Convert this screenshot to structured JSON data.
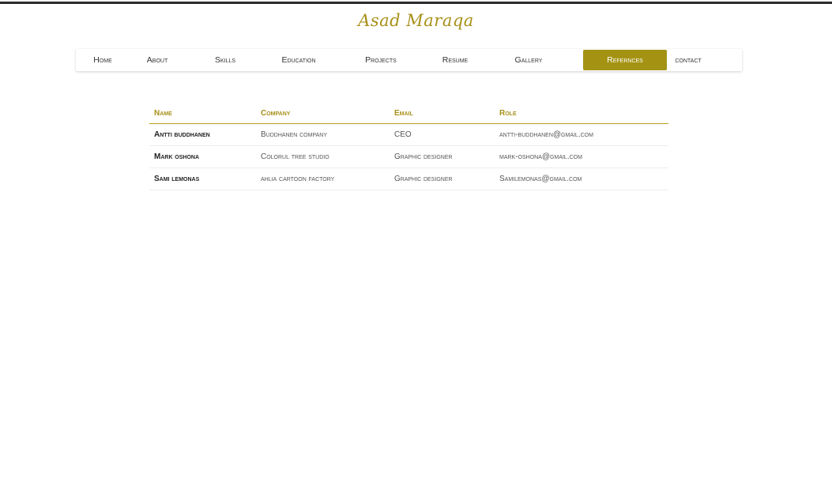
{
  "brand": "Asad Maraqa",
  "nav": {
    "items": [
      "Home",
      "About",
      "Skills",
      "Education",
      "Projects",
      "Resume",
      "Gallery",
      "Refernces",
      "contact"
    ],
    "active": "Refernces"
  },
  "table": {
    "headers": [
      "Name",
      "Company",
      "Email",
      "Role"
    ],
    "rows": [
      [
        "Antti buddhanen",
        "Buddhanen company",
        "CEO",
        "antti-buddhanen@gmail.com"
      ],
      [
        "Mark oshona",
        "Colorul tree studio",
        "Graphic designer",
        "mark-oshona@gmail.com"
      ],
      [
        "Sami lemonas",
        "ahlia cartoon factory",
        "Graphic designer",
        "Samilemonas@gmail.com"
      ]
    ]
  },
  "colors": {
    "accent": "#a49313",
    "brand_text": "#a8901a",
    "top_rule": "#2b2b2b"
  }
}
